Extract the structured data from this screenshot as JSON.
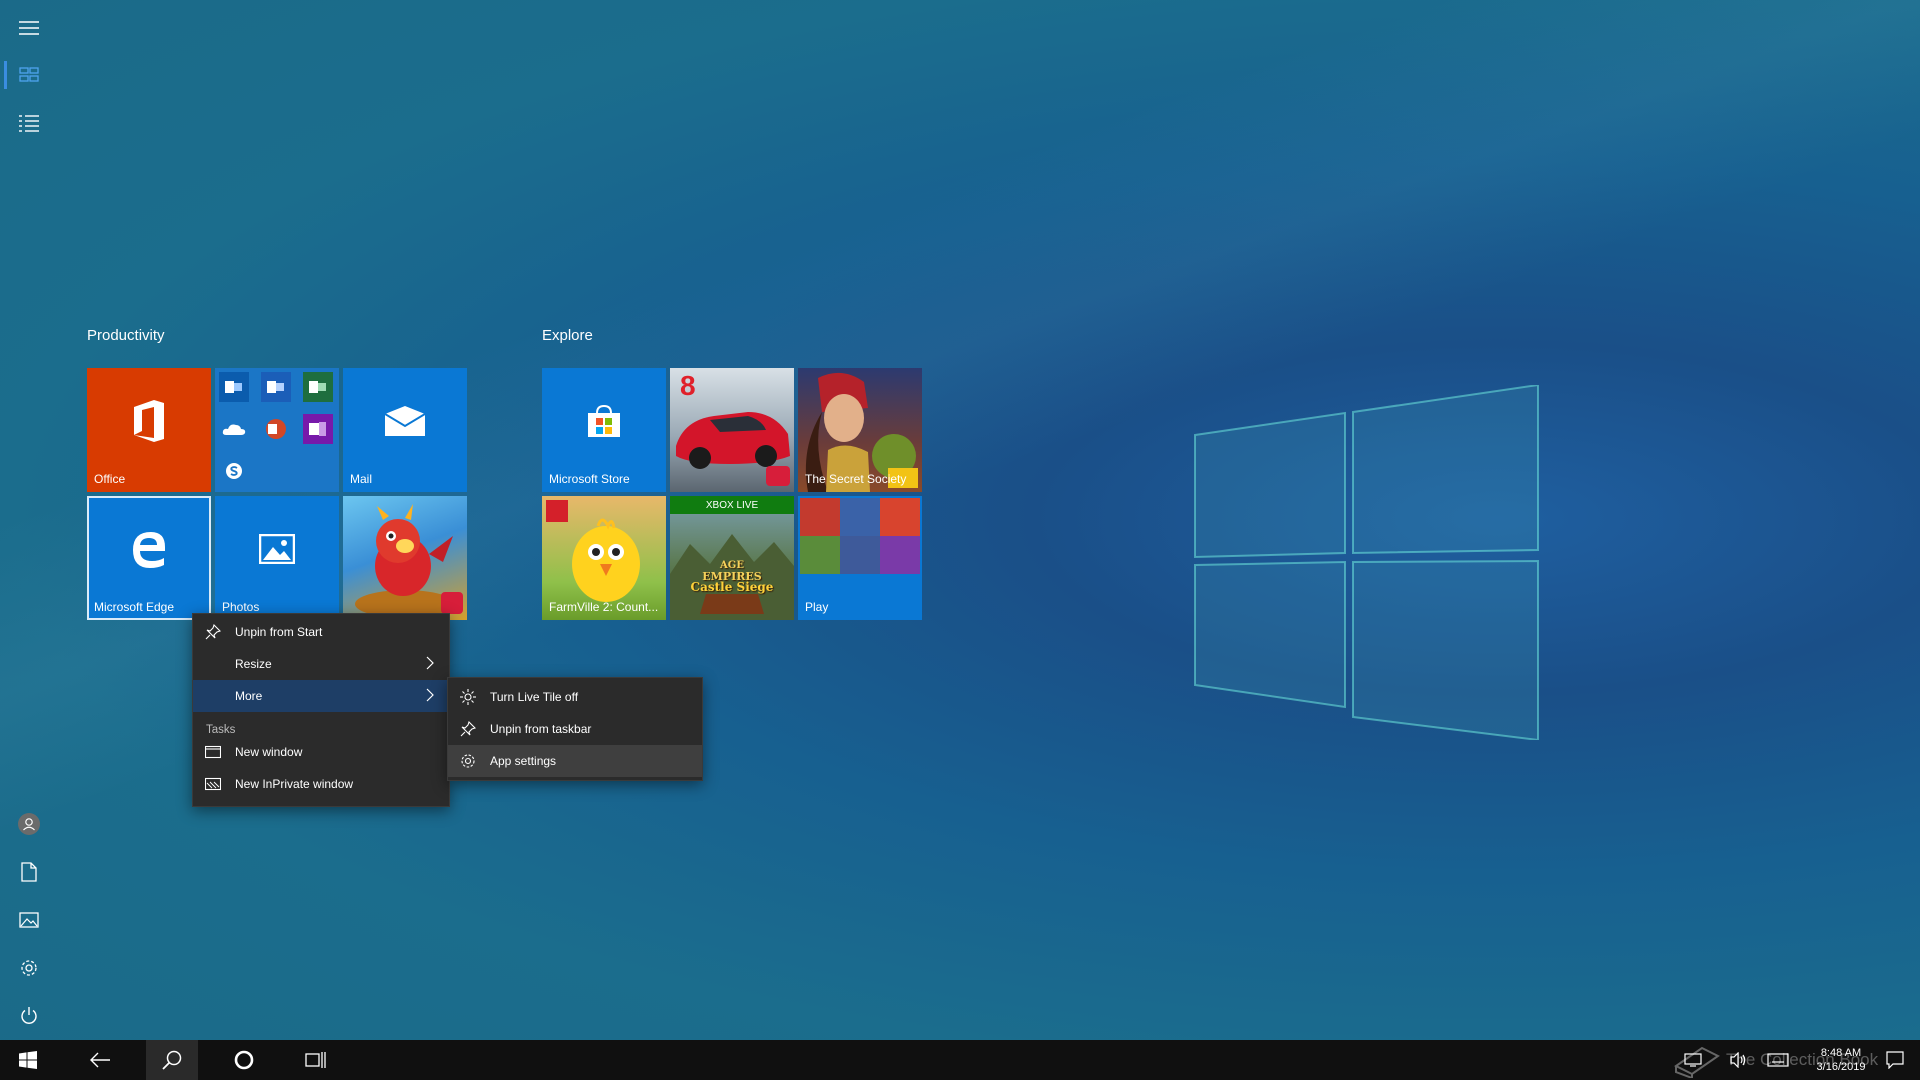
{
  "groups": [
    {
      "title": "Productivity"
    },
    {
      "title": "Explore"
    }
  ],
  "tiles": {
    "office": {
      "label": "Office",
      "color": "#d83b01"
    },
    "office_apps": {
      "color": "#1b76c6"
    },
    "mail": {
      "label": "Mail",
      "color": "#0a78d4"
    },
    "edge": {
      "label": "Microsoft Edge",
      "color": "#0a78d4"
    },
    "photos": {
      "label": "Photos",
      "color": "#0a78d4"
    },
    "dragon_game": {
      "label": ""
    },
    "store": {
      "label": "Microsoft Store",
      "color": "#0a78d4"
    },
    "asphalt": {
      "label": "8"
    },
    "secret_society": {
      "label": "The Secret Society"
    },
    "farmville": {
      "label": "FarmVille 2: Count..."
    },
    "age_of_empires": {
      "badge": "XBOX LIVE",
      "title_line1": "AGE",
      "title_line2": "EMPIRES",
      "title_line3": "Castle Siege"
    },
    "play": {
      "label": "Play",
      "color": "#0a78d4"
    }
  },
  "context_menu": {
    "items": [
      {
        "label": "Unpin from Start"
      },
      {
        "label": "Resize"
      },
      {
        "label": "More"
      }
    ],
    "tasks_header": "Tasks",
    "tasks": [
      {
        "label": "New window"
      },
      {
        "label": "New InPrivate window"
      }
    ]
  },
  "submenu": {
    "items": [
      {
        "label": "Turn Live Tile off"
      },
      {
        "label": "Unpin from taskbar"
      },
      {
        "label": "App settings"
      }
    ]
  },
  "taskbar": {
    "time": "8:48 AM",
    "date": "3/16/2019",
    "watermark": "The Collection Book"
  }
}
